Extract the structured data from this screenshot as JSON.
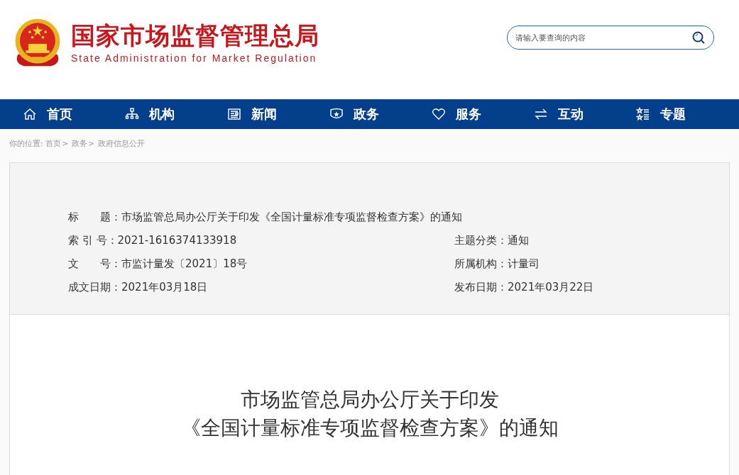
{
  "header": {
    "title": "国家市场监督管理总局",
    "subtitle": "State Administration for Market Regulation",
    "search": {
      "placeholder": "请输入要查询的内容"
    }
  },
  "nav": [
    {
      "label": "首页"
    },
    {
      "label": "机构"
    },
    {
      "label": "新闻"
    },
    {
      "label": "政务"
    },
    {
      "label": "服务"
    },
    {
      "label": "互动"
    },
    {
      "label": "专题"
    }
  ],
  "breadcrumb": {
    "prefix": "你的位置:",
    "separator": ">",
    "items": [
      "首页",
      "政务",
      "政府信息公开"
    ]
  },
  "meta": [
    [
      {
        "label": "标　　题：",
        "value": "市场监管总局办公厅关于印发《全国计量标准专项监督检查方案》的通知"
      }
    ],
    [
      {
        "label": "索 引 号：",
        "value": "2021-1616374133918"
      },
      {
        "label": "主题分类：",
        "value": "通知"
      }
    ],
    [
      {
        "label": "文　　号：",
        "value": "市监计量发〔2021〕18号"
      },
      {
        "label": "所属机构：",
        "value": "计量司"
      }
    ],
    [
      {
        "label": "成文日期：",
        "value": "2021年03月18日"
      },
      {
        "label": "发布日期：",
        "value": "2021年03月22日"
      }
    ]
  ],
  "article": {
    "title_lines": [
      "市场监管总局办公厅关于印发",
      "《全国计量标准专项监督检查方案》的通知"
    ]
  }
}
